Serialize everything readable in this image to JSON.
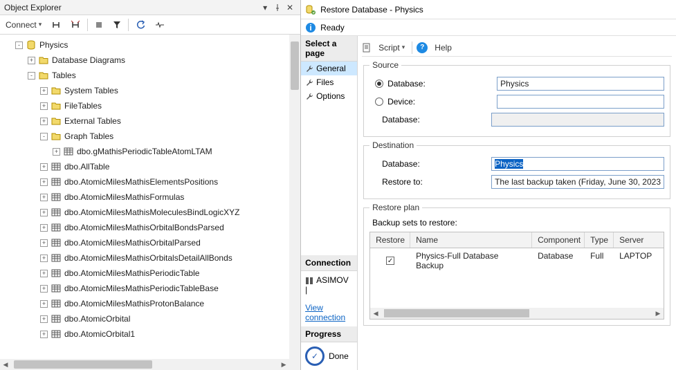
{
  "explorer": {
    "title": "Object Explorer",
    "connect": "Connect",
    "tree": [
      {
        "depth": 1,
        "exp": "-",
        "icon": "db",
        "label": "Physics"
      },
      {
        "depth": 2,
        "exp": "+",
        "icon": "folder",
        "label": "Database Diagrams"
      },
      {
        "depth": 2,
        "exp": "-",
        "icon": "folder",
        "label": "Tables"
      },
      {
        "depth": 3,
        "exp": "+",
        "icon": "folder",
        "label": "System Tables"
      },
      {
        "depth": 3,
        "exp": "+",
        "icon": "folder",
        "label": "FileTables"
      },
      {
        "depth": 3,
        "exp": "+",
        "icon": "folder",
        "label": "External Tables"
      },
      {
        "depth": 3,
        "exp": "-",
        "icon": "folder",
        "label": "Graph Tables"
      },
      {
        "depth": 4,
        "exp": "+",
        "icon": "table",
        "label": "dbo.gMathisPeriodicTableAtomLTAM"
      },
      {
        "depth": 3,
        "exp": "+",
        "icon": "table",
        "label": "dbo.AllTable"
      },
      {
        "depth": 3,
        "exp": "+",
        "icon": "table",
        "label": "dbo.AtomicMilesMathisElementsPositions"
      },
      {
        "depth": 3,
        "exp": "+",
        "icon": "table",
        "label": "dbo.AtomicMilesMathisFormulas"
      },
      {
        "depth": 3,
        "exp": "+",
        "icon": "table",
        "label": "dbo.AtomicMilesMathisMoleculesBindLogicXYZ"
      },
      {
        "depth": 3,
        "exp": "+",
        "icon": "table",
        "label": "dbo.AtomicMilesMathisOrbitalBondsParsed"
      },
      {
        "depth": 3,
        "exp": "+",
        "icon": "table",
        "label": "dbo.AtomicMilesMathisOrbitalParsed"
      },
      {
        "depth": 3,
        "exp": "+",
        "icon": "table",
        "label": "dbo.AtomicMilesMathisOrbitalsDetailAllBonds"
      },
      {
        "depth": 3,
        "exp": "+",
        "icon": "table",
        "label": "dbo.AtomicMilesMathisPeriodicTable"
      },
      {
        "depth": 3,
        "exp": "+",
        "icon": "table",
        "label": "dbo.AtomicMilesMathisPeriodicTableBase"
      },
      {
        "depth": 3,
        "exp": "+",
        "icon": "table",
        "label": "dbo.AtomicMilesMathisProtonBalance"
      },
      {
        "depth": 3,
        "exp": "+",
        "icon": "table",
        "label": "dbo.AtomicOrbital"
      },
      {
        "depth": 3,
        "exp": "+",
        "icon": "table",
        "label": "dbo.AtomicOrbital1"
      }
    ]
  },
  "restore": {
    "title": "Restore Database - Physics",
    "status": "Ready",
    "pages_header": "Select a page",
    "pages": [
      "General",
      "Files",
      "Options"
    ],
    "conn_header": "Connection",
    "conn_value": "ASIMOV |",
    "view_conn": "View connection",
    "progress_header": "Progress",
    "progress_value": "Done",
    "toolbar_script": "Script",
    "toolbar_help": "Help",
    "source_legend": "Source",
    "source_db_label": "Database:",
    "source_db_value": "Physics",
    "source_dev_label": "Device:",
    "source_dbonly_label": "Database:",
    "dest_legend": "Destination",
    "dest_db_label": "Database:",
    "dest_db_value": "Physics",
    "dest_restoreto_label": "Restore to:",
    "dest_restoreto_value": "The last backup taken (Friday, June 30, 2023",
    "plan_legend": "Restore plan",
    "plan_sub": "Backup sets to restore:",
    "grid_headers": [
      "Restore",
      "Name",
      "Component",
      "Type",
      "Server"
    ],
    "grid_row": {
      "name": "Physics-Full Database Backup",
      "component": "Database",
      "type": "Full",
      "server": "LAPTOP"
    }
  }
}
